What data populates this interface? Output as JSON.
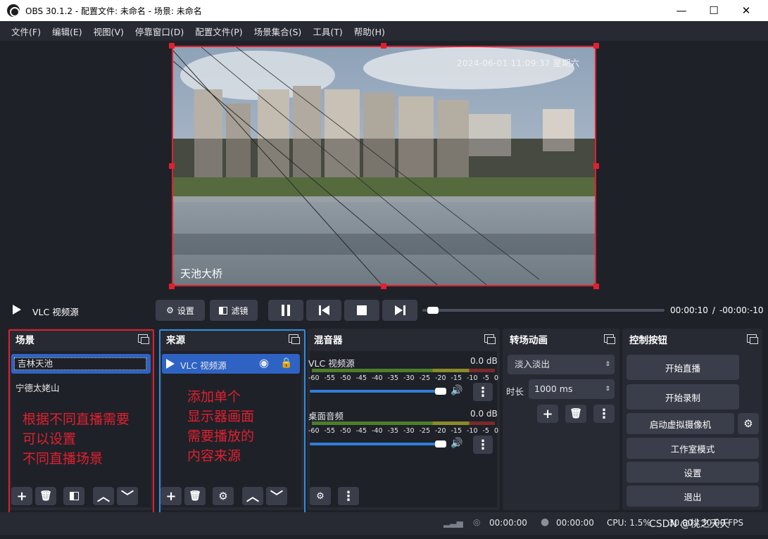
{
  "window": {
    "title": "OBS 30.1.2 - 配置文件: 未命名 - 场景: 未命名",
    "minimize": "—",
    "maximize": "☐",
    "close": "✕"
  },
  "menu": [
    "文件(F)",
    "编辑(E)",
    "视图(V)",
    "停靠窗口(D)",
    "配置文件(P)",
    "场景集合(S)",
    "工具(T)",
    "帮助(H)"
  ],
  "preview": {
    "timestamp": "2024-06-01 11:09:37 星期六",
    "caption": "天池大桥"
  },
  "media": {
    "source_name": "VLC 视频源",
    "settings_label": "设置",
    "filters_label": "滤镜",
    "time_elapsed": "00:00:10",
    "time_sep": "/",
    "time_remaining": "-00:00:-10",
    "progress": 0.02
  },
  "scenes": {
    "title": "场景",
    "items": [
      "吉林天池",
      "宁德太姥山"
    ],
    "selected_index": 0
  },
  "sources": {
    "title": "来源",
    "items": [
      "VLC 视频源"
    ]
  },
  "mixer": {
    "title": "混音器",
    "channels": [
      {
        "name": "VLC 视频源",
        "db": "0.0 dB",
        "volume": 0.92
      },
      {
        "name": "桌面音频",
        "db": "0.0 dB",
        "volume": 0.92
      }
    ],
    "ticks": [
      "-60",
      "-55",
      "-50",
      "-45",
      "-40",
      "-35",
      "-30",
      "-25",
      "-20",
      "-15",
      "-10",
      "-5",
      "0"
    ]
  },
  "transitions": {
    "title": "转场动画",
    "selected": "淡入淡出",
    "duration_label": "时长",
    "duration_value": "1000 ms"
  },
  "controls": {
    "title": "控制按钮",
    "buttons": [
      "开始直播",
      "开始录制",
      "启动虚拟摄像机",
      "工作室模式",
      "设置",
      "退出"
    ]
  },
  "annotations": {
    "scenes_note": [
      "根据不同直播需要",
      "可以设置",
      "不同直播场景"
    ],
    "sources_note": [
      "添加单个",
      "显示器画面",
      "需要播放的",
      "内容来源"
    ],
    "scenes_color": "#e0202e",
    "sources_color": "#2f8fe0"
  },
  "status": {
    "stream_time": "00:00:00",
    "record_time": "00:00:00",
    "cpu": "CPU: 1.5%",
    "fps": "30.00 / 30.00 FPS",
    "watermark": "CSDN @桃之夭夭"
  }
}
